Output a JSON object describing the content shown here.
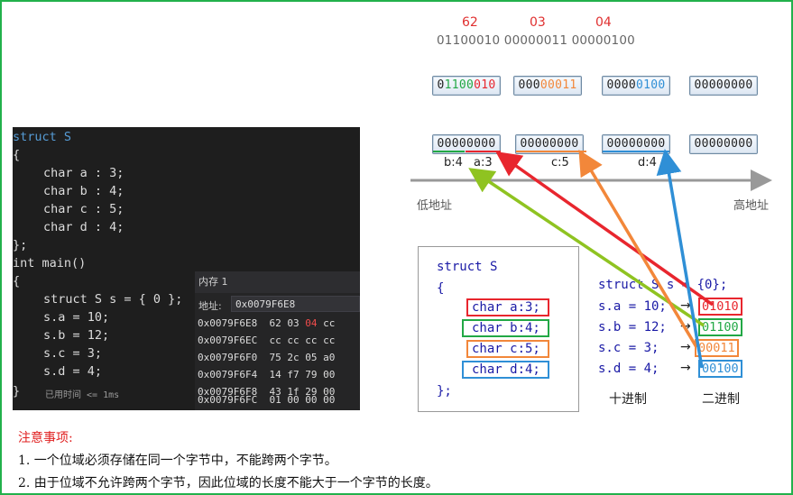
{
  "top": {
    "hex": [
      "62",
      "03",
      "04"
    ],
    "binary": "01100010  00000011  00000100"
  },
  "row1": {
    "b0": [
      "0",
      "1100",
      "010"
    ],
    "b1": [
      "000",
      "00011"
    ],
    "b2": [
      "0000",
      "0100"
    ],
    "b3": "00000000"
  },
  "row2": [
    "00000000",
    "00000000",
    "00000000",
    "00000000"
  ],
  "row2_labels": {
    "b4": "b:4",
    "a3": "a:3",
    "c5": "c:5",
    "d4": "d:4"
  },
  "axis": {
    "low": "低地址",
    "high": "高地址"
  },
  "code": {
    "lines": [
      "struct S",
      "{",
      "char a : 3;",
      "char b : 4;",
      "char c : 5;",
      "char d : 4;",
      "};",
      "int main()",
      "{",
      "struct S s = { 0 };",
      "s.a = 10;",
      "s.b = 12;",
      "s.c = 3;",
      "s.d = 4;",
      "}"
    ],
    "timing": "已用时间 <= 1ms"
  },
  "memory": {
    "title": "内存 1",
    "addr_label": "地址:",
    "addr_value": "0x0079F6E8",
    "rows": [
      {
        "addr": "0x0079F6E8",
        "b": [
          "62",
          "03",
          "04",
          "cc"
        ]
      },
      {
        "addr": "0x0079F6EC",
        "b": [
          "cc",
          "cc",
          "cc",
          "cc"
        ]
      },
      {
        "addr": "0x0079F6F0",
        "b": [
          "75",
          "2c",
          "05",
          "a0"
        ]
      },
      {
        "addr": "0x0079F6F4",
        "b": [
          "14",
          "f7",
          "79",
          "00"
        ]
      },
      {
        "addr": "0x0079F6F8",
        "b": [
          "43",
          "1f",
          "29",
          "00"
        ]
      },
      {
        "addr": "0x0079F6FC",
        "b": [
          "01",
          "00",
          "00",
          "00"
        ]
      }
    ]
  },
  "struct_box": {
    "head": "struct S",
    "open": "{",
    "fields": [
      "char a:3;",
      "char b:4;",
      "char c:5;",
      "char d:4;"
    ],
    "close": "};"
  },
  "assign": {
    "head": "struct S s = {0};",
    "lines": [
      "s.a = 10;",
      "s.b = 12;",
      "s.c = 3;",
      "s.d = 4;"
    ],
    "arrow": "→",
    "bins": [
      "01010",
      "01100",
      "00011",
      "00100"
    ]
  },
  "captions": {
    "dec": "十进制",
    "bin": "二进制"
  },
  "notes": {
    "title": "注意事项:",
    "items": [
      "1.  一个位域必须存储在同一个字节中，不能跨两个字节。",
      "2.  由于位域不允许跨两个字节，因此位域的长度不能大于一个字节的长度。"
    ]
  },
  "colors": {
    "a": "#e8262e",
    "b": "#22a845",
    "c": "#f2873a",
    "d": "#2f8fd6",
    "frame": "#22b14c"
  }
}
